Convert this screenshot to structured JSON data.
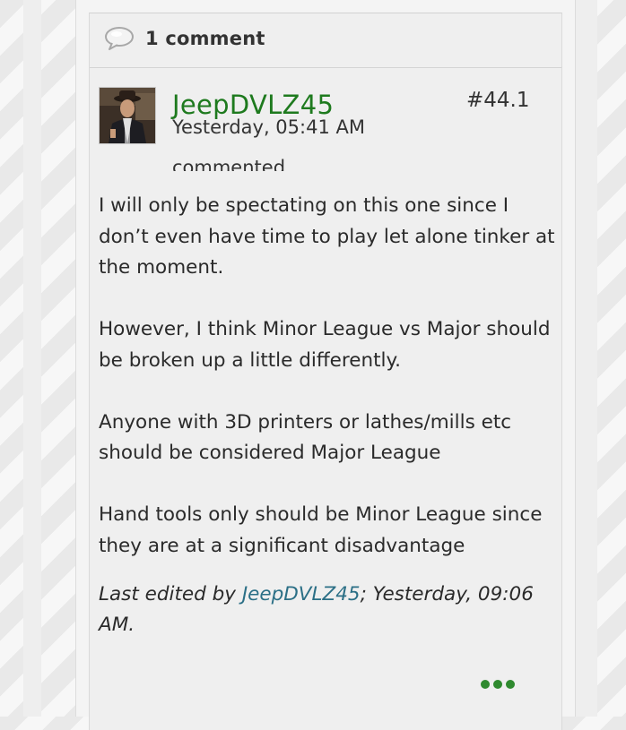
{
  "comments": {
    "count_label": "1 comment"
  },
  "comment": {
    "author": "JeepDVLZ45",
    "post_number": "#44.1",
    "timestamp": "Yesterday, 05:41 AM",
    "action_text": "commented",
    "paragraphs": [
      "I will only be spectating on this one since I don’t even have time to play let alone tinker at the moment.",
      "However, I think Minor League vs Major should be broken up a little differently.",
      "Anyone with 3D printers or lathes/mills etc should be considered Major League",
      "Hand tools only should be Minor League since they are at a significant disadvantage"
    ],
    "edit": {
      "prefix": "Last edited by ",
      "editor": "JeepDVLZ45",
      "suffix": "; Yesterday, 09:06 AM."
    }
  },
  "icons": {
    "comment_bubble": "speech-bubble-icon",
    "more": "more-options-icon"
  },
  "colors": {
    "author_green": "#1e7a1e",
    "link_teal": "#2b6f86",
    "dots_green": "#2f8a2f"
  }
}
